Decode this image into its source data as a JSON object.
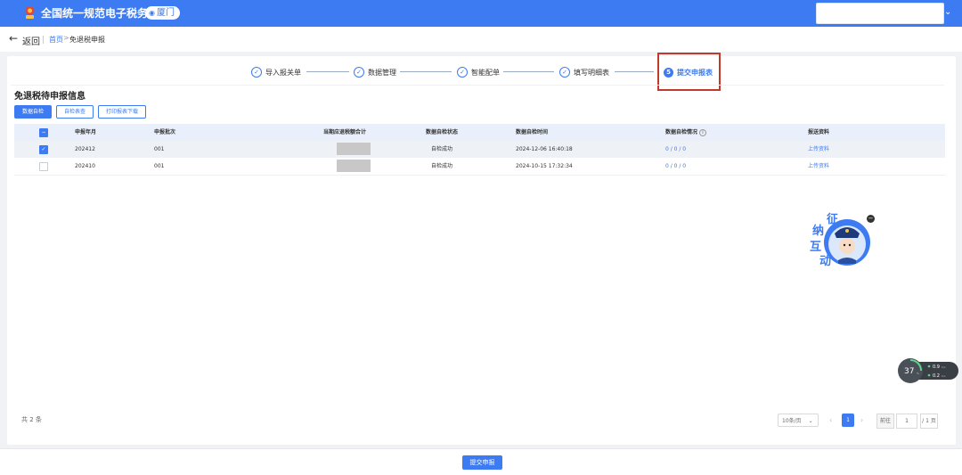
{
  "header": {
    "app_title": "全国统一规范电子税务局",
    "city": "厦门",
    "brand_color": "#3d7bf2"
  },
  "nav": {
    "back_label": "返回",
    "breadcrumb": [
      "首页",
      "免退税申报"
    ],
    "breadcrumb_sep": ">"
  },
  "steps": [
    {
      "label": "导入报关单",
      "status": "done"
    },
    {
      "label": "数据管理",
      "status": "done"
    },
    {
      "label": "智能配单",
      "status": "done"
    },
    {
      "label": "填写明细表",
      "status": "done"
    },
    {
      "label": "提交申报表",
      "status": "active",
      "number": "5"
    }
  ],
  "section": {
    "title": "免退税待申报信息",
    "buttons": [
      "数据自检",
      "自检表查",
      "打印报表下载"
    ]
  },
  "table": {
    "columns": [
      "申报年月",
      "申报批次",
      "当期应退税额合计",
      "数据自检状态",
      "数据自检时间",
      "数据自检情况",
      "报送资料"
    ],
    "rows": [
      {
        "checked": true,
        "period": "202412",
        "batch": "001",
        "status": "自检成功",
        "time": "2024-12-06 16:40:18",
        "check_result": "0 / 0 / 0",
        "material": "上传资料"
      },
      {
        "checked": false,
        "period": "202410",
        "batch": "001",
        "status": "自检成功",
        "time": "2024-10-15 17:32:34",
        "check_result": "0 / 0 / 0",
        "material": "上传资料"
      }
    ]
  },
  "pagination": {
    "total": "共 2 条",
    "page_size": "10条/页",
    "current_page": "1",
    "goto_label": "前往",
    "goto_value": "1",
    "page_total": "/ 1 页"
  },
  "mascot": {
    "chars": [
      "征",
      "纳",
      "互",
      "动"
    ]
  },
  "net_widget": {
    "percent": "37",
    "percent_unit": "%",
    "up": "0.9",
    "down": "0.2",
    "speed_unit": "K/s"
  },
  "footer": {
    "submit_label": "提交申报"
  }
}
